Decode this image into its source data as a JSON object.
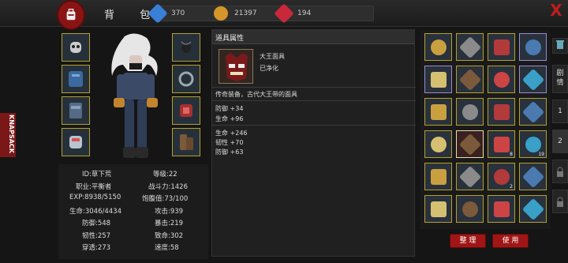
{
  "header": {
    "title": "背 包",
    "currencies": [
      {
        "icon": "blue-gem-icon",
        "value": "370",
        "color": "#3a7fd6"
      },
      {
        "icon": "gold-coin-icon",
        "value": "21397",
        "color": "#d4962a"
      },
      {
        "icon": "red-gem-icon",
        "value": "194",
        "color": "#c8283a"
      }
    ],
    "close_label": "X"
  },
  "side_tab": {
    "label": "KNAPSACK"
  },
  "right_tabs": [
    {
      "label": "剧情"
    },
    {
      "label": "1"
    },
    {
      "label": "2"
    }
  ],
  "equipment_slots": [
    {
      "name": "mask-slot"
    },
    {
      "name": "chest-armor-slot"
    },
    {
      "name": "leg-armor-slot"
    },
    {
      "name": "gauntlet-slot"
    },
    {
      "name": "amulet-slot"
    },
    {
      "name": "belt-slot"
    },
    {
      "name": "ring-slot"
    },
    {
      "name": "boot-slot"
    }
  ],
  "stats": {
    "id": "ID:草下荒",
    "level": "等级:22",
    "job": "职业:平衡者",
    "power": "战斗力:1426",
    "exp": "EXP:8938/5150",
    "hunger": "饱腹值:73/100",
    "hp": "生命:3046/4434",
    "attack": "攻击:939",
    "defense": "防御:548",
    "crit": "暴击:219",
    "toughness": "韧性:257",
    "fatal": "致命:302",
    "pierce": "穿透:273",
    "speed": "速度:58"
  },
  "item_panel": {
    "header": "道具属性",
    "name": "大王面具",
    "state": "已净化",
    "desc": "传奇装备，古代大王带的面具",
    "base": [
      "防御 +34",
      "生命 +96"
    ],
    "extra": [
      "生命 +246",
      "韧性 +70",
      "防御 +63"
    ]
  },
  "inventory": [
    {
      "name": "dagger"
    },
    {
      "name": "blade-spike"
    },
    {
      "name": "syringe-blade"
    },
    {
      "name": "top-hat-mask",
      "red": true
    },
    {
      "name": "armor-piece",
      "red": true
    },
    {
      "name": "leather-boots"
    },
    {
      "name": "stick"
    },
    {
      "name": "helmet",
      "red": true
    },
    {
      "name": "power-fist"
    },
    {
      "name": "boots-2"
    },
    {
      "name": "goggles"
    },
    {
      "name": "power-fist-2"
    },
    {
      "name": "hook-ring"
    },
    {
      "name": "king-mask",
      "selected": true
    },
    {
      "name": "gold-bar",
      "count": "8"
    },
    {
      "name": "card",
      "count": "19"
    },
    {
      "name": "blade-bottle"
    },
    {
      "name": "red-bottle"
    },
    {
      "name": "vial",
      "count": "2"
    },
    {
      "name": "blood-flask"
    },
    {
      "name": "horn"
    },
    {
      "name": "blue-mushroom"
    },
    {
      "name": "bolt"
    },
    {
      "name": "red-mushroom"
    }
  ],
  "buttons": {
    "sort": "整 理",
    "use": "使 用"
  }
}
